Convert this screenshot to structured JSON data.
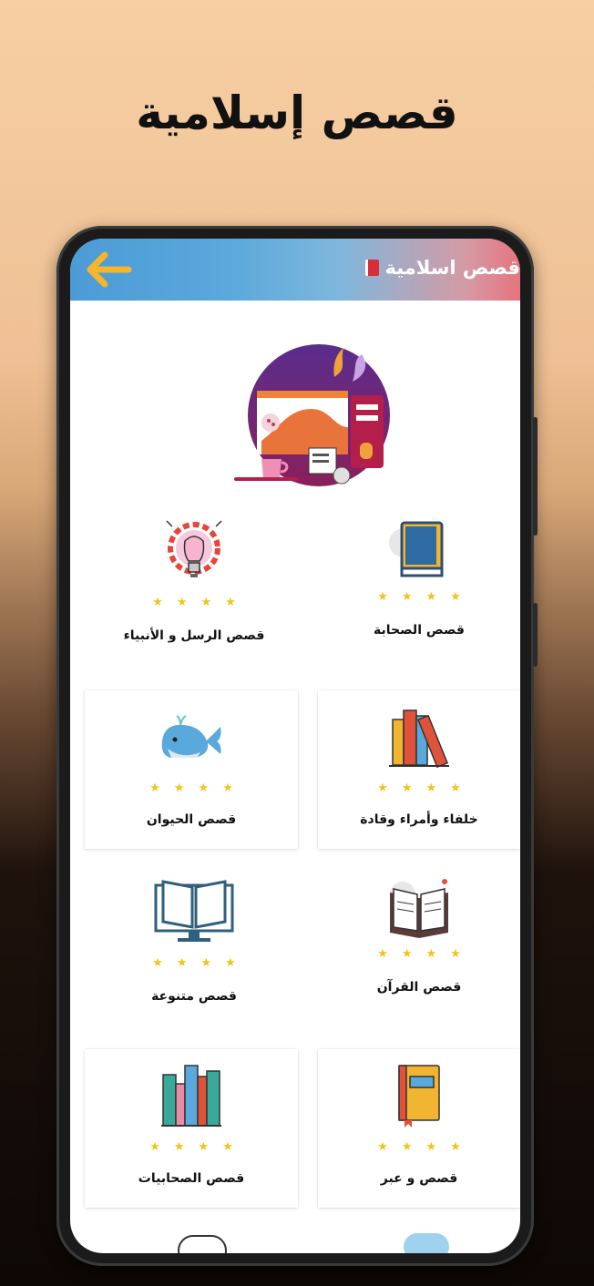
{
  "promo": {
    "title": "قصص إسلامية"
  },
  "appbar": {
    "title": "قصص اسلامية"
  },
  "cards": [
    {
      "label": "قصص الرسل و الأنبياء",
      "icon": "lightbulb-gear-icon",
      "stars": "★★★★"
    },
    {
      "label": "قصص الصحابة",
      "icon": "quran-book-icon",
      "stars": "★★★★"
    },
    {
      "label": "قصص الحيوان",
      "icon": "whale-icon",
      "stars": "★★★★"
    },
    {
      "label": "خلفاء وأمراء وقادة",
      "icon": "books-stack-icon",
      "stars": "★★★★"
    },
    {
      "label": "قصص متنوعة",
      "icon": "open-book-monitor-icon",
      "stars": "★★★★"
    },
    {
      "label": "قصص القرآن",
      "icon": "open-book-icon",
      "stars": "★★★★"
    },
    {
      "label": "قصص الصحابيات",
      "icon": "bookshelf-icon",
      "stars": "★★★★"
    },
    {
      "label": "قصص و عبر",
      "icon": "closed-book-icon",
      "stars": "★★★★"
    }
  ]
}
